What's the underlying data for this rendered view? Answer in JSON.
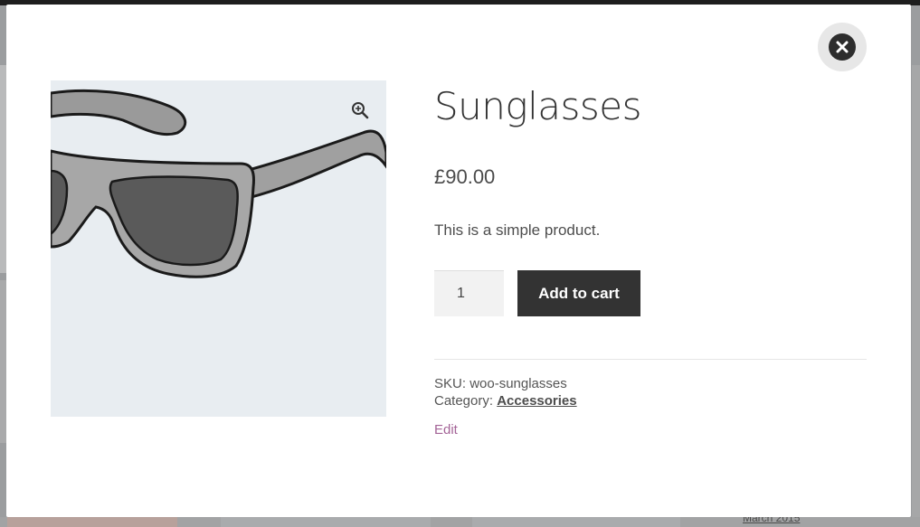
{
  "product": {
    "title": "Sunglasses",
    "price": "£90.00",
    "description": "This is a simple product.",
    "quantity": "1",
    "add_to_cart_label": "Add to cart",
    "sku_label": "SKU:",
    "sku_value": "woo-sunglasses",
    "category_label": "Category:",
    "category_value": "Accessories",
    "edit_label": "Edit"
  },
  "background": {
    "archive_link": "March 2015"
  },
  "colors": {
    "button_dark": "#333333",
    "edit_link": "#a46497",
    "image_bg": "#e8edf1"
  }
}
